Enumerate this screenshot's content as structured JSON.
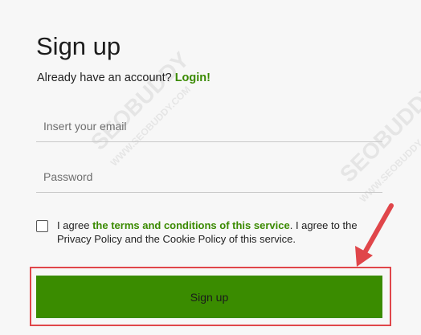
{
  "form": {
    "title": "Sign up",
    "already_text": "Already have an account? ",
    "login_link": "Login!",
    "email_placeholder": "Insert your email",
    "password_placeholder": "Password",
    "terms_prefix": "I agree ",
    "terms_link": "the terms and conditions of this service",
    "terms_suffix": ". I agree to the Privacy Policy and the Cookie Policy of this service.",
    "submit_label": "Sign up"
  },
  "watermark": {
    "brand": "SEOBUDDY",
    "site": "WWW.SEOBUDDY.COM"
  },
  "colors": {
    "accent_green": "#3a8a00",
    "button_green": "#3a8c00",
    "annotation_red": "#e0464a",
    "background": "#f7f7f7"
  },
  "annotation": {
    "icons": [
      "red-arrow-icon",
      "red-highlight-box"
    ]
  }
}
